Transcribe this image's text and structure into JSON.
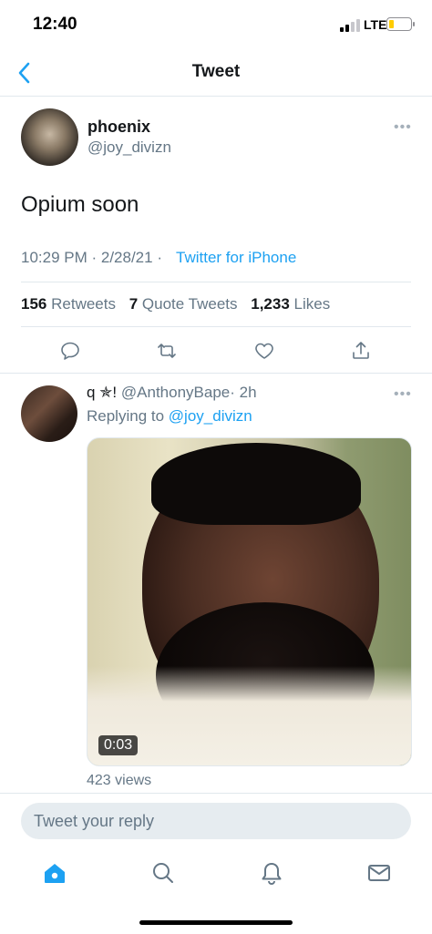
{
  "status_bar": {
    "time": "12:40",
    "network": "LTE",
    "battery_color": "#ffcc00"
  },
  "nav": {
    "title": "Tweet",
    "back_icon": "chevron-left-icon"
  },
  "tweet": {
    "author_name": "phoenix",
    "author_handle": "@joy_divizn",
    "text": "Opium soon",
    "time": "10:29 PM · 2/28/21 · ",
    "source": "Twitter for iPhone",
    "retweets_count": "156",
    "retweets_label": "Retweets",
    "quotes_count": "7",
    "quotes_label": "Quote Tweets",
    "likes_count": "1,233",
    "likes_label": "Likes",
    "more_label": "•••"
  },
  "reply": {
    "author_name": "q ✯!",
    "author_handle": "@AnthonyBape",
    "age": "· 2h",
    "replying_prefix": "Replying to",
    "replying_handle": "@joy_divizn",
    "video_duration": "0:03",
    "views": "423 views",
    "more_label": "•••"
  },
  "composer": {
    "placeholder": "Tweet your reply"
  },
  "tab_bar": {
    "items": [
      "home-icon",
      "search-icon",
      "notifications-icon",
      "messages-icon"
    ]
  },
  "colors": {
    "accent": "#1da1f2",
    "muted": "#657786",
    "divider": "#e1e8ed"
  }
}
